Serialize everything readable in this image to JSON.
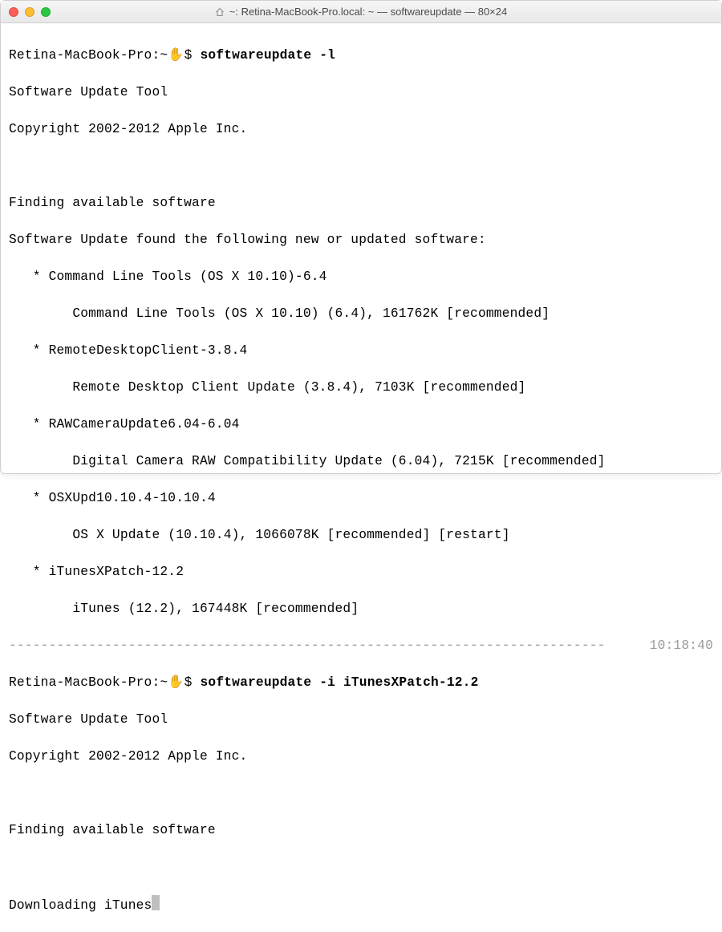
{
  "window": {
    "title": "~: Retina-MacBook-Pro.local: ~ — softwareupdate — 80×24"
  },
  "prompt": {
    "host_path": "Retina-MacBook-Pro:~",
    "hand": "✋",
    "dollar": "$"
  },
  "session1": {
    "command": "softwareupdate -l",
    "tool_line": "Software Update Tool",
    "copyright": "Copyright 2002-2012 Apple Inc.",
    "finding": "Finding available software",
    "found_line": "Software Update found the following new or updated software:",
    "items": [
      {
        "name": "Command Line Tools (OS X 10.10)-6.4",
        "desc": "Command Line Tools (OS X 10.10) (6.4), 161762K [recommended]"
      },
      {
        "name": "RemoteDesktopClient-3.8.4",
        "desc": "Remote Desktop Client Update (3.8.4), 7103K [recommended]"
      },
      {
        "name": "RAWCameraUpdate6.04-6.04",
        "desc": "Digital Camera RAW Compatibility Update (6.04), 7215K [recommended]"
      },
      {
        "name": "OSXUpd10.10.4-10.10.4",
        "desc": "OS X Update (10.10.4), 1066078K [recommended] [restart]"
      },
      {
        "name": "iTunesXPatch-12.2",
        "desc": "iTunes (12.2), 167448K [recommended]"
      }
    ]
  },
  "divider": {
    "dashes": "---------------------------------------------------------------------------",
    "time": "10:18:40"
  },
  "session2": {
    "command": "softwareupdate -i iTunesXPatch-12.2",
    "tool_line": "Software Update Tool",
    "copyright": "Copyright 2002-2012 Apple Inc.",
    "finding": "Finding available software",
    "downloading": "Downloading iTunes"
  }
}
